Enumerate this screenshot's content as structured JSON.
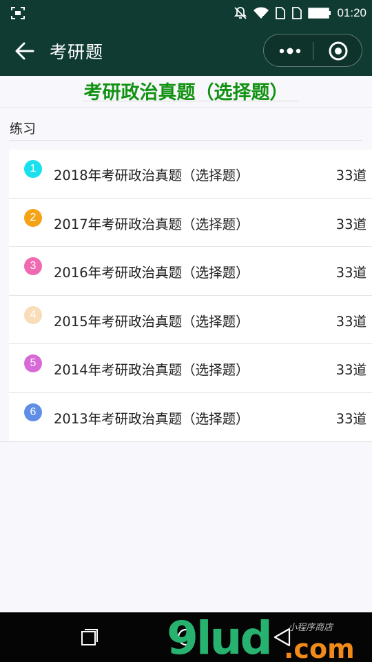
{
  "status_bar": {
    "time": "01:20",
    "icons": [
      "scan-icon",
      "mute-bell-icon",
      "wifi-icon",
      "sim1-icon",
      "sim2-icon",
      "battery-icon"
    ]
  },
  "nav": {
    "title": "考研题",
    "icons": [
      "back-arrow-icon",
      "more-dots-icon",
      "close-target-icon"
    ]
  },
  "page": {
    "title": "考研政治真题（选择题）",
    "section_label": "练习"
  },
  "exams": [
    {
      "index": "1",
      "title": "2018年考研政治真题（选择题）",
      "count": "33道",
      "color": "#19e0ee"
    },
    {
      "index": "2",
      "title": "2017年考研政治真题（选择题）",
      "count": "33道",
      "color": "#f5a216"
    },
    {
      "index": "3",
      "title": "2016年考研政治真题（选择题）",
      "count": "33道",
      "color": "#ef6ab0"
    },
    {
      "index": "4",
      "title": "2015年考研政治真题（选择题）",
      "count": "33道",
      "color": "#f9dcb8"
    },
    {
      "index": "5",
      "title": "2014年考研政治真题（选择题）",
      "count": "33道",
      "color": "#d86ad8"
    },
    {
      "index": "6",
      "title": "2013年考研政治真题（选择题）",
      "count": "33道",
      "color": "#5e8ee6"
    }
  ],
  "system_nav": {
    "icons": [
      "recent-apps-icon",
      "home-icon",
      "back-triangle-icon"
    ]
  },
  "watermark": {
    "logo_text": "9lud.com",
    "sub_text": "小程序商店"
  }
}
